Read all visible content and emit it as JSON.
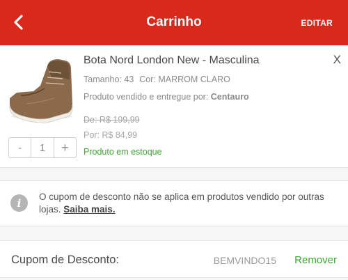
{
  "header": {
    "title": "Carrinho",
    "edit_label": "EDITAR",
    "color": "#d9291c"
  },
  "product": {
    "name": "Bota Nord London New - Masculina",
    "close_label": "X",
    "size": "Tamanho: 43",
    "color_text": "Cor: MARROM CLARO",
    "seller_prefix": "Produto vendido e entregue por:",
    "seller_name": "Centauro",
    "price_old": "De: R$ 199,99",
    "price_new": "Por: R$ 84,99",
    "stock": "Produto em estoque",
    "quantity": "1",
    "minus_label": "-",
    "plus_label": "+"
  },
  "notice": {
    "text": "O cupom de desconto não se aplica em produtos vendido por outras lojas.",
    "link": "Saiba mais.",
    "icon_label": "i"
  },
  "coupon": {
    "label": "Cupom de Desconto:",
    "code": "BEMVINDO15",
    "remove_label": "Remover"
  }
}
